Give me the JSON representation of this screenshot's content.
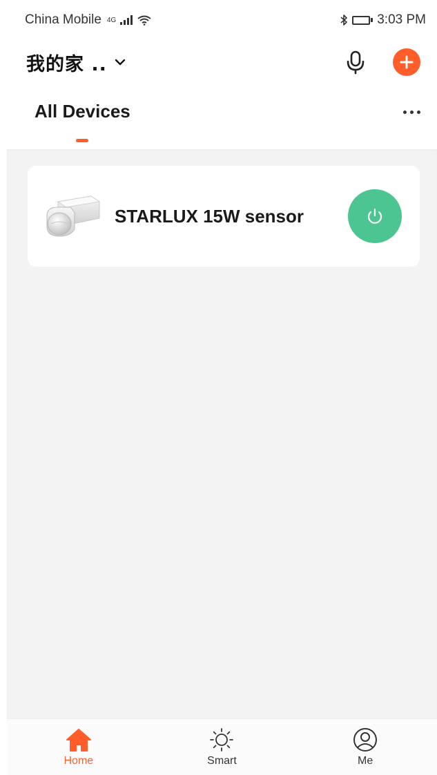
{
  "status_bar": {
    "carrier": "China Mobile",
    "network": "4G",
    "time": "3:03 PM"
  },
  "header": {
    "home_name": "我的家 ..",
    "icons": [
      "chevron-down-icon",
      "microphone-icon",
      "plus-icon"
    ],
    "accent_color": "#ff5e2b"
  },
  "tabs": {
    "active_label": "All Devices",
    "more_icon": "more-horizontal-icon"
  },
  "devices": [
    {
      "name": "STARLUX 15W sensor",
      "icon": "motion-sensor-image",
      "power_on": true,
      "power_color": "#4cc592"
    }
  ],
  "bottom_nav": {
    "items": [
      {
        "label": "Home",
        "icon": "home-icon",
        "active": true
      },
      {
        "label": "Smart",
        "icon": "sun-icon",
        "active": false
      },
      {
        "label": "Me",
        "icon": "user-icon",
        "active": false
      }
    ]
  }
}
